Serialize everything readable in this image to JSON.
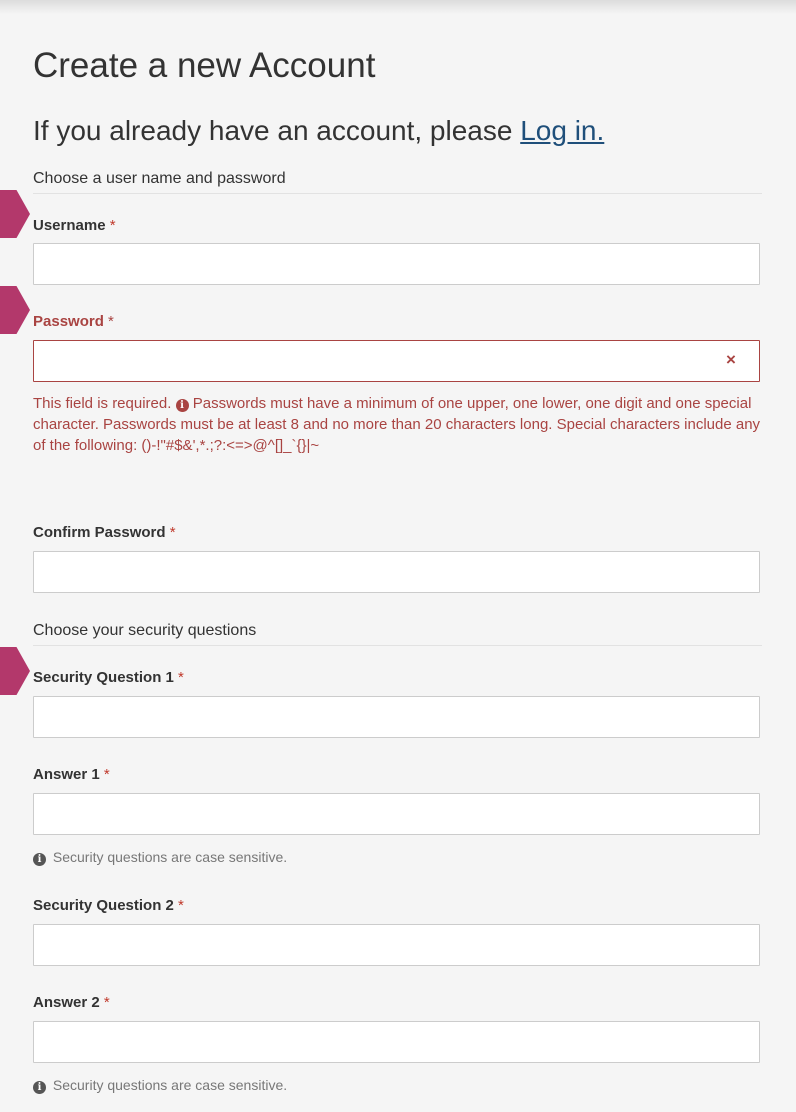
{
  "page": {
    "title": "Create a new Account",
    "subtitle_prefix": "If you already have an account, please ",
    "login_link": "Log in."
  },
  "sections": {
    "credentials": "Choose a user name and password",
    "security": "Choose your security questions"
  },
  "fields": {
    "username": {
      "label": "Username",
      "required": "*",
      "value": ""
    },
    "password": {
      "label": "Password",
      "required": "*",
      "value": "",
      "error_icon": "×"
    },
    "confirm_password": {
      "label": "Confirm Password",
      "required": "*",
      "value": ""
    },
    "security_question_1": {
      "label": "Security Question 1",
      "required": "*",
      "value": ""
    },
    "answer_1": {
      "label": "Answer 1",
      "required": "*",
      "value": ""
    },
    "security_question_2": {
      "label": "Security Question 2",
      "required": "*",
      "value": ""
    },
    "answer_2": {
      "label": "Answer 2",
      "required": "*",
      "value": ""
    }
  },
  "messages": {
    "password_required": "This field is required.",
    "password_rules": "Passwords must have a minimum of one upper, one lower, one digit and one special character. Passwords must be at least 8 and no more than 20 characters long. Special characters include any of the following: ()-!\"#$&',*.;?:<=>@^[]_`{}|~",
    "case_sensitive_1": "Security questions are case sensitive.",
    "case_sensitive_2": "Security questions are case sensitive."
  },
  "icons": {
    "info": "info-circle-icon",
    "error": "times-icon",
    "marker": "arrow-marker-icon"
  },
  "colors": {
    "error": "#a94442",
    "link": "#1f4f7a",
    "marker": "#b3386b",
    "background": "#f5f5f5"
  }
}
